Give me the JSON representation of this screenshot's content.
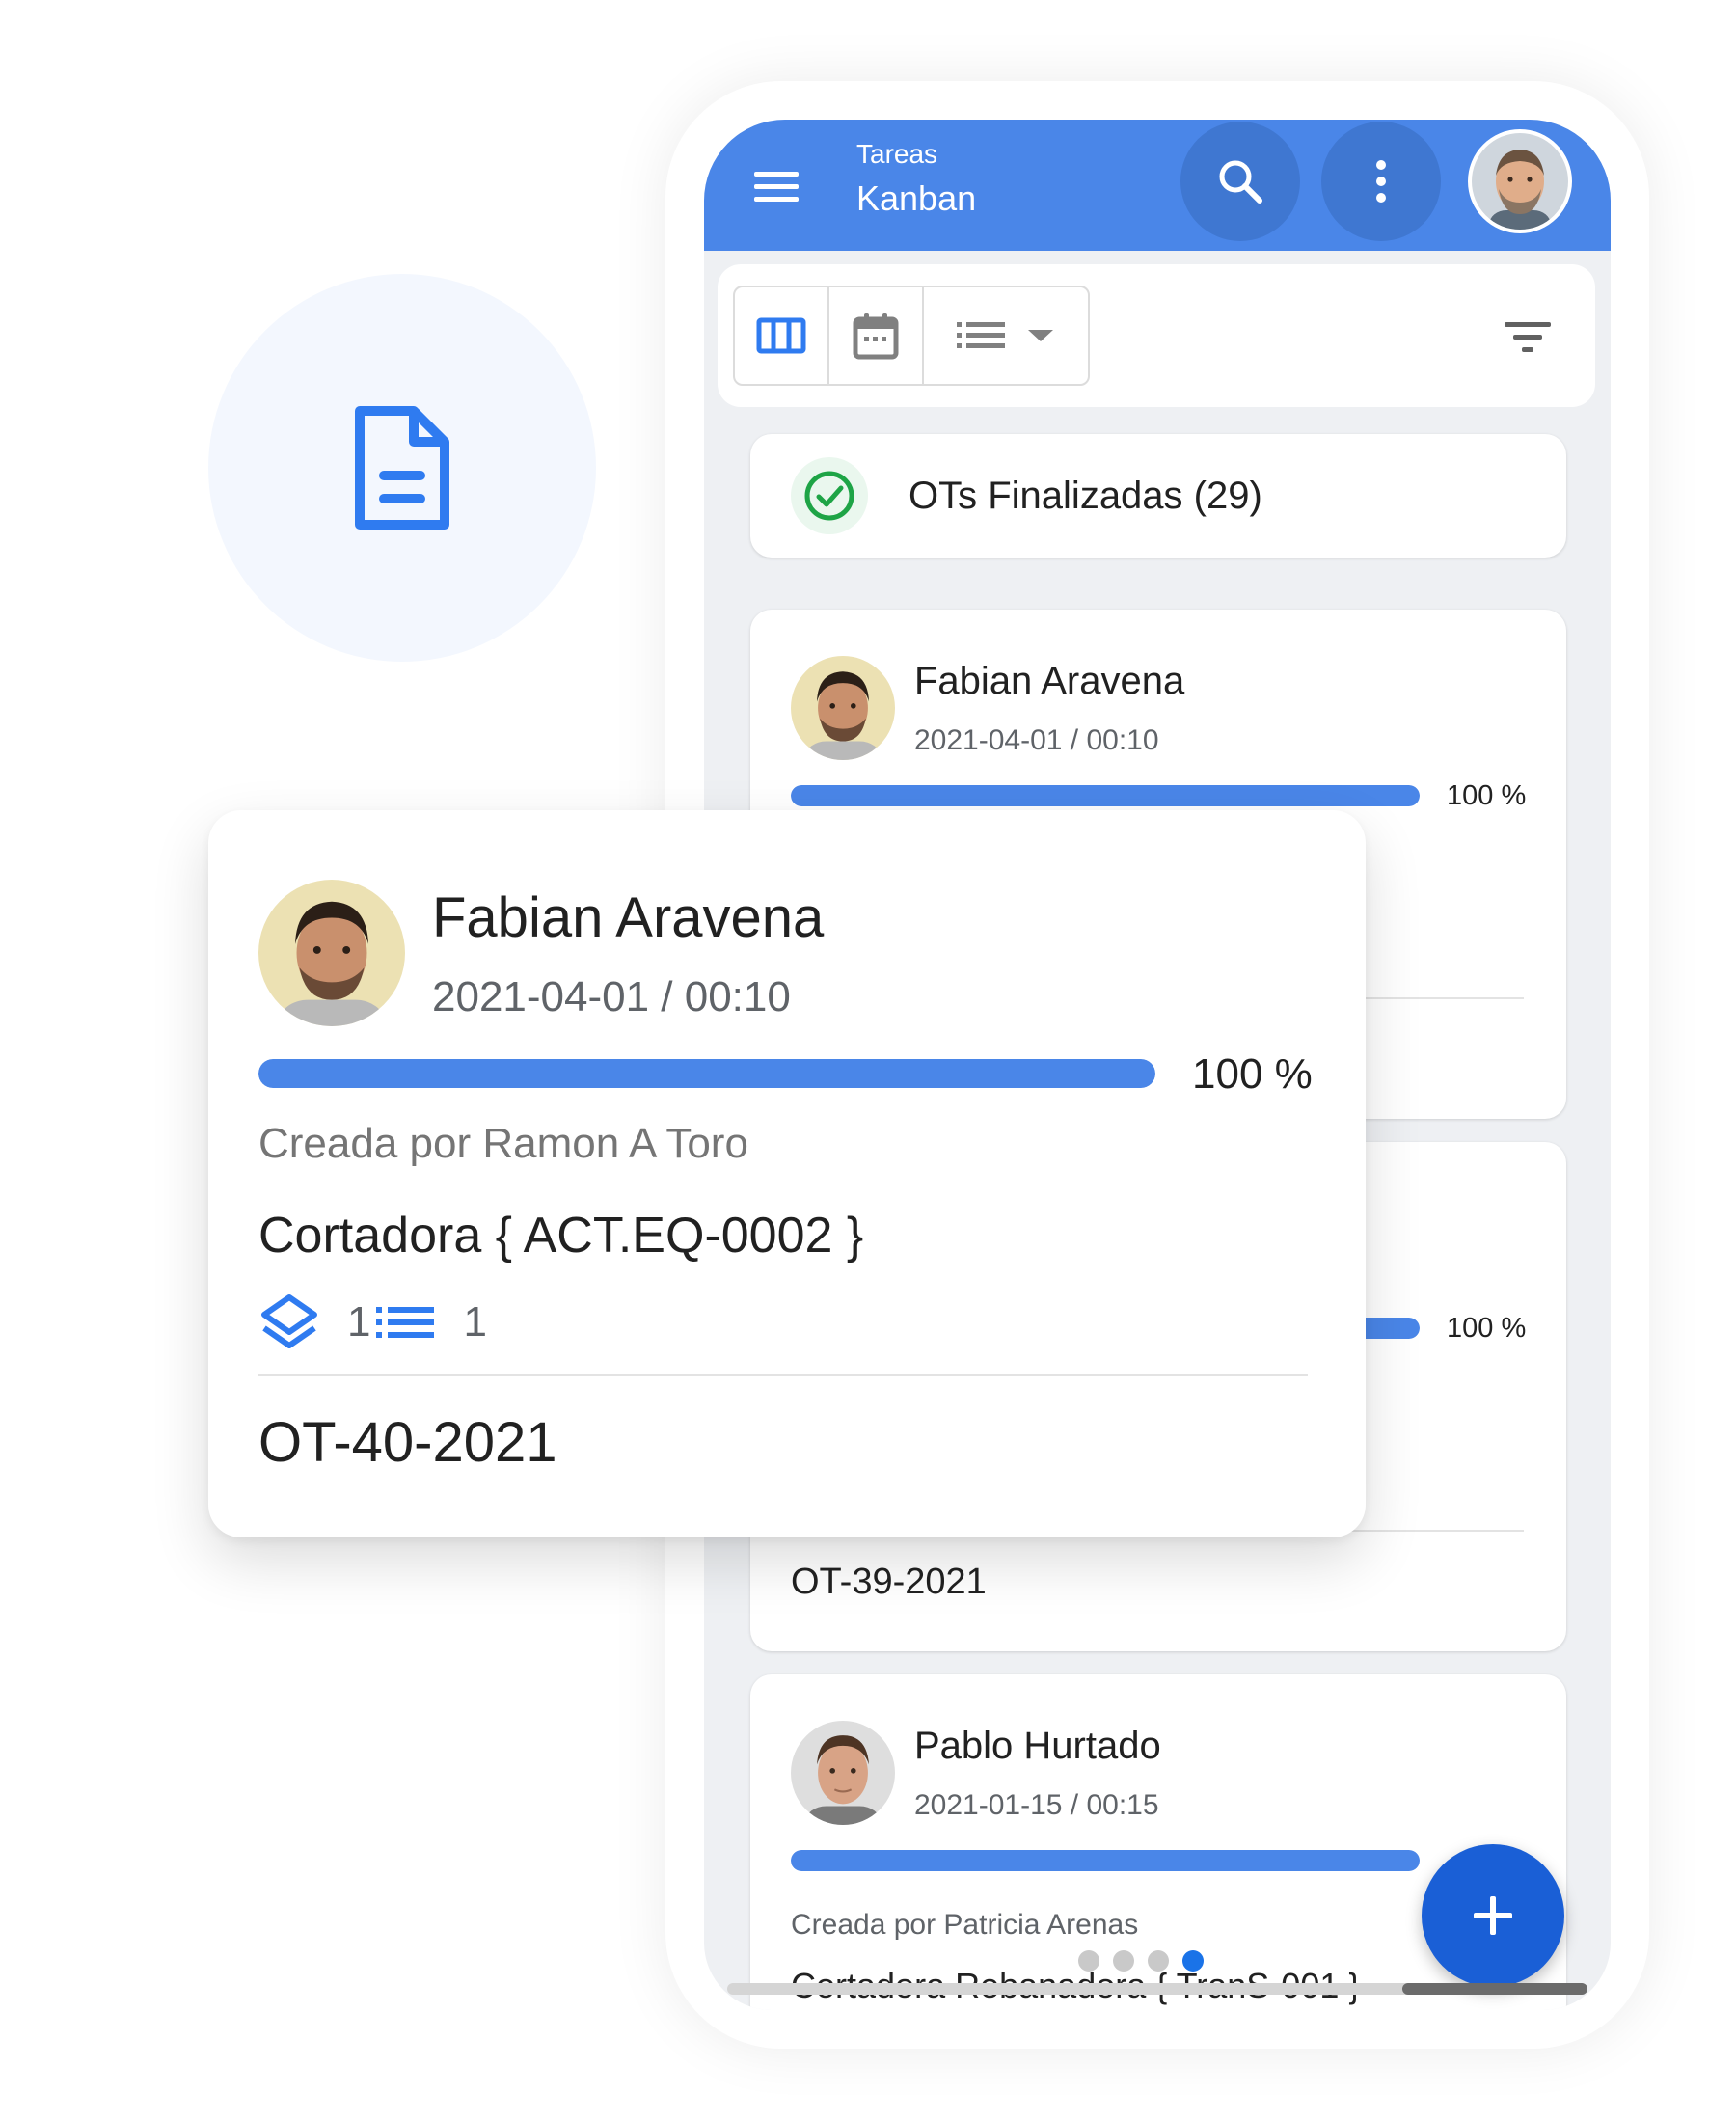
{
  "appbar": {
    "section_label": "Tareas",
    "view_title": "Kanban",
    "icons": {
      "menu": "menu-icon",
      "search": "search-icon",
      "more": "more-vertical-icon"
    }
  },
  "toolbar": {
    "views": [
      {
        "icon": "kanban-columns-icon",
        "selected": true
      },
      {
        "icon": "calendar-icon",
        "selected": false
      },
      {
        "icon": "list-icon",
        "selected": false,
        "has_dropdown": true
      }
    ],
    "filter_icon": "filter-icon"
  },
  "status_group": {
    "label": "OTs Finalizadas (29)",
    "icon": "check-circle-icon"
  },
  "cards": [
    {
      "assignee": "Fabian Aravena",
      "datetime": "2021-04-01 / 00:10",
      "progress": 1.0,
      "progress_label": "100 %"
    },
    {
      "progress": 1.0,
      "progress_label": "100 %",
      "code": "OT-39-2021"
    },
    {
      "assignee": "Pablo Hurtado",
      "datetime": "2021-01-15 / 00:15",
      "progress": 1.0,
      "created_by": "Creada por Patricia Arenas",
      "asset": "Cortadora Rebanadora { TranS-001 }"
    }
  ],
  "featured_card": {
    "assignee": "Fabian Aravena",
    "datetime": "2021-04-01 / 00:10",
    "progress": 1.0,
    "progress_label": "100 %",
    "created_by": "Creada por Ramon A Toro",
    "asset": "Cortadora { ACT.EQ-0002 }",
    "layers_count": "1",
    "tasks_count": "1",
    "code": "OT-40-2021"
  },
  "pager": {
    "pages": 4,
    "active_index": 3
  },
  "fab": {
    "icon": "plus-icon"
  },
  "colors": {
    "primary": "#4a86e8",
    "primary_dark": "#3f77d1",
    "fab": "#1a5fd6",
    "success": "#1ea446",
    "decor_circle": "#f3f7fe"
  }
}
